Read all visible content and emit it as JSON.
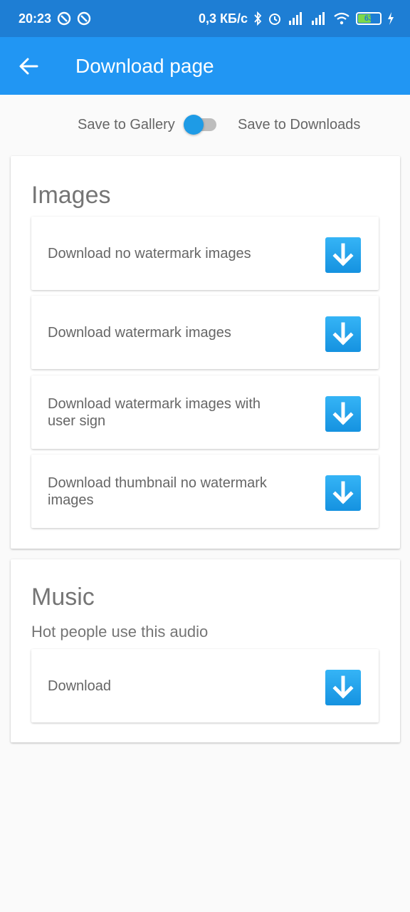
{
  "status_bar": {
    "time": "20:23",
    "network_speed": "0,3 КБ/с",
    "battery_level": "63",
    "battery_percent": 63,
    "icons": [
      "sync-icon",
      "sync-icon",
      "bluetooth-icon",
      "alarm-icon",
      "signal-icon",
      "signal-icon",
      "wifi-icon",
      "battery-icon",
      "charging-icon"
    ]
  },
  "app_bar": {
    "title": "Download page",
    "back_icon": "arrow-back-icon"
  },
  "save_toggle": {
    "left_label": "Save to Gallery",
    "right_label": "Save to Downloads",
    "state": "off"
  },
  "images_section": {
    "title": "Images",
    "items": [
      {
        "label": "Download no watermark images"
      },
      {
        "label": "Download watermark images"
      },
      {
        "label": "Download watermark images with user sign"
      },
      {
        "label": "Download thumbnail no watermark images"
      }
    ]
  },
  "music_section": {
    "title": "Music",
    "subtitle": "Hot people use this audio",
    "items": [
      {
        "label": "Download"
      }
    ]
  },
  "colors": {
    "status_bar": "#1e7ed4",
    "app_bar": "#2196f3",
    "download_button": "#1e9be6",
    "background": "#fafafa"
  }
}
